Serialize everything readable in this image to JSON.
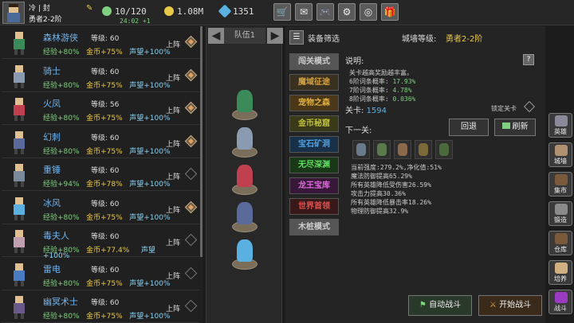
{
  "player": {
    "name": "冷 | 封",
    "rank": "勇者2-2阶"
  },
  "resources": {
    "stamina": "10/120",
    "gold": "1.08M",
    "gems": "1351",
    "timer": "24:02 +1"
  },
  "topmenu": [
    {
      "icon": "cart-icon",
      "glyph": "🛒"
    },
    {
      "icon": "mail-icon",
      "glyph": "✉"
    },
    {
      "icon": "gamepad-icon",
      "glyph": "🎮"
    },
    {
      "icon": "gear-icon",
      "glyph": "⚙"
    },
    {
      "icon": "color-wheel-icon",
      "glyph": "◎"
    },
    {
      "icon": "gift-icon",
      "glyph": "🎁"
    }
  ],
  "heroes": [
    {
      "name": "森林游侠",
      "level": "等级: 60",
      "exp": "经验+80%",
      "gold": "金币+75%",
      "fame": "声望+100%",
      "status": "上阵",
      "deployed": true,
      "color": "#3a8a5a"
    },
    {
      "name": "骑士",
      "level": "等级: 60",
      "exp": "经验+80%",
      "gold": "金币+75%",
      "fame": "声望+100%",
      "status": "上阵",
      "deployed": true,
      "color": "#8a9ab0"
    },
    {
      "name": "火凤",
      "level": "等级: 56",
      "exp": "经验+80%",
      "gold": "金币+75%",
      "fame": "声望+100%",
      "status": "上阵",
      "deployed": true,
      "color": "#c04050"
    },
    {
      "name": "幻刺",
      "level": "等级: 60",
      "exp": "经验+80%",
      "gold": "金币+75%",
      "fame": "声望+100%",
      "status": "上阵",
      "deployed": true,
      "color": "#5a6a9a"
    },
    {
      "name": "重锤",
      "level": "等级: 60",
      "exp": "经验+94%",
      "gold": "金币+78%",
      "fame": "声望+100%",
      "status": "上阵",
      "deployed": false,
      "color": "#7a8a9a"
    },
    {
      "name": "冰风",
      "level": "等级: 60",
      "exp": "经验+80%",
      "gold": "金币+75%",
      "fame": "声望+100%",
      "status": "上阵",
      "deployed": true,
      "color": "#5ab0e0"
    },
    {
      "name": "毒夫人",
      "level": "等级: 60",
      "exp": "经验+80%",
      "gold": "金币+77.4%",
      "fame": "声望",
      "fame2": "+100%",
      "status": "上阵",
      "deployed": false,
      "color": "#c0a0b0"
    },
    {
      "name": "雷电",
      "level": "等级: 60",
      "exp": "经验+80%",
      "gold": "金币+75%",
      "fame": "声望+100%",
      "status": "上阵",
      "deployed": false,
      "color": "#4a7ac0"
    },
    {
      "name": "幽冥术士",
      "level": "等级: 60",
      "exp": "经验+80%",
      "gold": "金币+75%",
      "fame": "声望+100%",
      "status": "上阵",
      "deployed": false,
      "color": "#6a5a8a"
    }
  ],
  "team": {
    "label": "队伍1",
    "prev": "◀",
    "next": "▶"
  },
  "filter": {
    "label": "装备筛选",
    "icon": "☰"
  },
  "city": {
    "label": "城墙等级:",
    "value": "勇者2-2阶"
  },
  "modes": [
    {
      "label": "闯关模式",
      "color": "#ccc",
      "bg": "#555"
    },
    {
      "label": "魔域征途",
      "color": "#d0a040",
      "bg": "#3a3020"
    },
    {
      "label": "宠物之森",
      "color": "#e0b040",
      "bg": "#4a3818"
    },
    {
      "label": "金币秘窟",
      "color": "#c0c040",
      "bg": "#3a3a18"
    },
    {
      "label": "宝石矿洞",
      "color": "#50a0e0",
      "bg": "#183048"
    },
    {
      "label": "无尽深渊",
      "color": "#60e060",
      "bg": "#183818"
    },
    {
      "label": "龙王宝库",
      "color": "#e06ae0",
      "bg": "#381838"
    },
    {
      "label": "世界首领",
      "color": "#e05050",
      "bg": "#381818"
    },
    {
      "label": "木桩模式",
      "color": "#ccc",
      "bg": "#555"
    }
  ],
  "desc": {
    "title": "说明:",
    "help": "?",
    "line1": "关卡越高奖励越丰富。",
    "l6": "6阶词条概率:",
    "v6": "17.93%",
    "l7": "7阶词条概率:",
    "v7": "4.78%",
    "l8": "8阶词条概率:",
    "v8": "0.036%"
  },
  "stage": {
    "label": "关卡:",
    "value": "1594",
    "lock": "锁定关卡"
  },
  "next": {
    "label": "下一关:",
    "back": "回退",
    "refresh": "刷新"
  },
  "stats": [
    "当前强度:279.2%,净化值:51%",
    "魔法防御提高65.29%",
    "所有英雄降低受伤害26.59%",
    "攻击力提高30.36%",
    "所有英雄降低暴击率18.26%",
    "物理防御提高32.9%"
  ],
  "actions": {
    "auto": "自动战斗",
    "start": "开始战斗"
  },
  "side": [
    {
      "label": "英雄",
      "color": "#8a8a9a"
    },
    {
      "label": "城墙",
      "color": "#b09070"
    },
    {
      "label": "集市",
      "color": "#7a5a3a"
    },
    {
      "label": "锻造",
      "color": "#8a8a8a"
    },
    {
      "label": "仓库",
      "color": "#7a5a3a"
    },
    {
      "label": "培养",
      "color": "#d0b080"
    },
    {
      "label": "战斗",
      "color": "#9a3ac0"
    }
  ]
}
